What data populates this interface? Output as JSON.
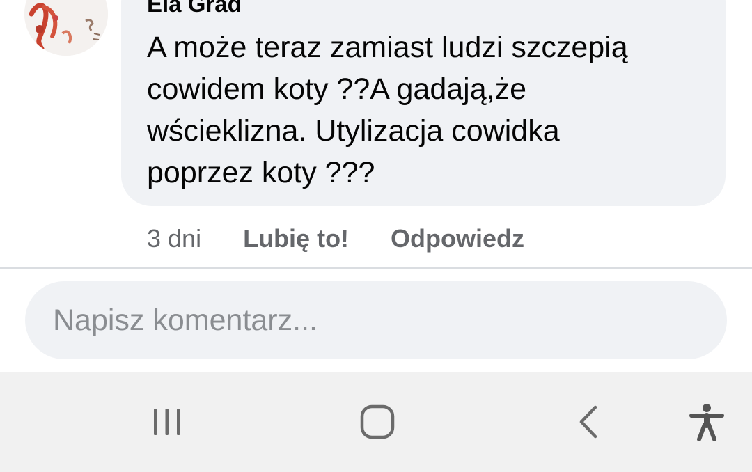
{
  "comment": {
    "author": "Ela Grad",
    "text_lines": [
      "A może teraz zamiast ludzi szczepią",
      "cowidem koty ??A gadają,że",
      "wścieklizna. Utylizacja cowidka",
      "poprzez koty ???"
    ],
    "timestamp": "3 dni",
    "like_label": "Lubię to!",
    "reply_label": "Odpowiedz",
    "avatar_icon": "profile-avatar"
  },
  "composer": {
    "placeholder": "Napisz komentarz..."
  },
  "nav_bar": {
    "buttons": [
      {
        "icon": "recent-apps-icon"
      },
      {
        "icon": "home-icon"
      },
      {
        "icon": "back-icon"
      },
      {
        "icon": "accessibility-icon"
      }
    ]
  },
  "colors": {
    "bubble_bg": "#f0f2f5",
    "text": "#050505",
    "secondary_text": "#65676b",
    "placeholder": "#8a8d91",
    "navbar_bg": "#f1f1f1",
    "nav_icon": "#6b6b6b"
  }
}
